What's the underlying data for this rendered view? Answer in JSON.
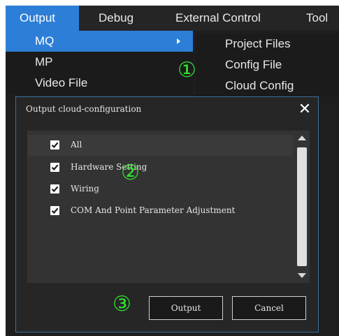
{
  "menubar": {
    "items": [
      {
        "label": "Output"
      },
      {
        "label": "Debug"
      },
      {
        "label": "External Control"
      },
      {
        "label": "Tool"
      }
    ]
  },
  "output_menu": {
    "items": [
      {
        "label": "MQ"
      },
      {
        "label": "MP"
      },
      {
        "label": "Video File"
      }
    ]
  },
  "mq_submenu": {
    "items": [
      {
        "label": "Project Files"
      },
      {
        "label": "Config File"
      },
      {
        "label": "Cloud Config"
      }
    ]
  },
  "markers": {
    "one": "①",
    "two": "②",
    "three": "③"
  },
  "dialog": {
    "title": "Output cloud-configuration",
    "close_glyph": "✕",
    "options": [
      {
        "label": "All",
        "checked": true
      },
      {
        "label": "Hardware Setting",
        "checked": true
      },
      {
        "label": "Wiring",
        "checked": true
      },
      {
        "label": "COM And Point Parameter Adjustment",
        "checked": true
      }
    ],
    "output_button": "Output",
    "cancel_button": "Cancel"
  },
  "colors": {
    "accent": "#2d7ed6",
    "marker": "#2ee62e",
    "background": "#1e1e1e"
  }
}
